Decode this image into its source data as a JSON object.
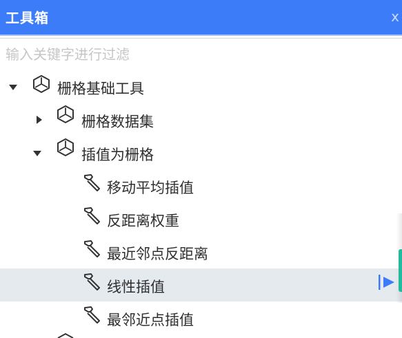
{
  "window": {
    "title": "工具箱",
    "close_glyph": "x"
  },
  "filter": {
    "placeholder": "输入关键字进行过滤",
    "value": ""
  },
  "tree": {
    "root": {
      "label": "栅格基础工具",
      "expanded": true,
      "icon": "cube-icon"
    },
    "dataset": {
      "label": "栅格数据集",
      "expanded": false,
      "icon": "cube-icon"
    },
    "interp": {
      "label": "插值为栅格",
      "expanded": true,
      "icon": "cube-icon"
    },
    "tools": [
      {
        "label": "移动平均插值",
        "icon": "hammer-icon"
      },
      {
        "label": "反距离权重",
        "icon": "hammer-icon"
      },
      {
        "label": "最近邻点反距离",
        "icon": "hammer-icon"
      },
      {
        "label": "线性插值",
        "icon": "hammer-icon",
        "selected": true
      },
      {
        "label": "最邻近点插值",
        "icon": "hammer-icon"
      }
    ]
  },
  "colors": {
    "title_bar": "#3d7cf8",
    "selected_row": "#e5eaef",
    "run_icon": "#3d7cf8",
    "edge_accent": "#23bba0"
  }
}
